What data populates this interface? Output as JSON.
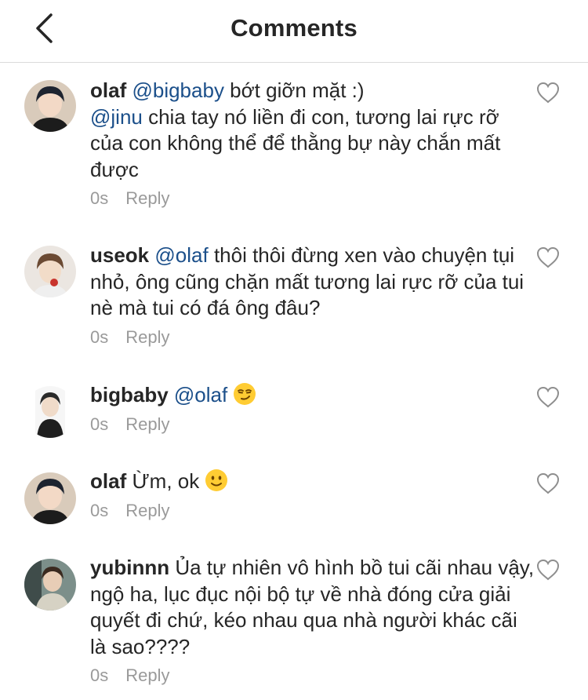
{
  "header": {
    "title": "Comments",
    "back_icon": "chevron-left-icon"
  },
  "actions": {
    "reply_label": "Reply"
  },
  "comments": [
    {
      "username": "olaf",
      "segments": [
        {
          "mention": "@bigbaby",
          "text": " bớt giỡn mặt :)"
        },
        {
          "mention": "@jinu",
          "text": " chia tay nó liền đi con, tương lai rực rỡ của con không thể để thằng bự này chắn mất được"
        }
      ],
      "time": "0s"
    },
    {
      "username": "useok",
      "segments": [
        {
          "mention": "@olaf",
          "text": " thôi thôi đừng xen vào chuyện tụi nhỏ, ông cũng chặn mất tương lai rực rỡ của tui nè mà tui có đá ông đâu?"
        }
      ],
      "time": "0s"
    },
    {
      "username": "bigbaby",
      "segments": [
        {
          "mention": "@olaf",
          "text": " ",
          "emoji": "smirking-face-emoji"
        }
      ],
      "time": "0s"
    },
    {
      "username": "olaf",
      "segments": [
        {
          "mention": "",
          "text": " Ừm, ok ",
          "emoji": "slightly-smiling-face-emoji"
        }
      ],
      "time": "0s"
    },
    {
      "username": "yubinnn",
      "segments": [
        {
          "mention": "",
          "text": " Ủa tự nhiên vô hình bồ tui cãi nhau vậy, ngộ ha, lục đục nội bộ tự về nhà đóng cửa giải quyết đi chứ, kéo nhau qua nhà người khác cãi là sao????"
        }
      ],
      "time": "0s"
    }
  ],
  "colors": {
    "mention": "#1b4f8a",
    "meta": "#9a9a9a",
    "text": "#262626",
    "divider": "#dbdbdb"
  }
}
